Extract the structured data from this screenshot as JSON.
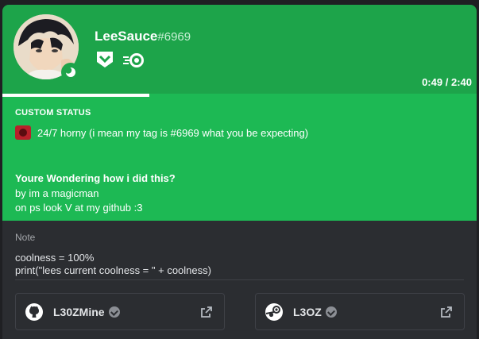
{
  "profile": {
    "username": "LeeSauce",
    "discriminator": "#6969",
    "avatar_alt": "user avatar",
    "status": "idle"
  },
  "badges": [
    "hypesquad-brilliance-icon",
    "nitro-boost-icon"
  ],
  "activity": {
    "elapsed": "0:49",
    "separator": "/",
    "total": "2:40",
    "progress_fraction": 0.31
  },
  "custom_status": {
    "title": "CUSTOM STATUS",
    "text": "24/7 horny (i mean my tag is #6969 what you be expecting)"
  },
  "about": {
    "heading": "Youre Wondering how i did this?",
    "line1": "by im a magicman",
    "line2": "on ps look V at my github :3"
  },
  "note": {
    "label": "Note",
    "text": "coolness = 100%\nprint(\"lees current coolness = \" + coolness)"
  },
  "connections": [
    {
      "service": "github",
      "name": "L30ZMine",
      "verified": true
    },
    {
      "service": "steam",
      "name": "L3OZ",
      "verified": true
    }
  ],
  "colors": {
    "header": "#1da44a",
    "accent": "#1db954",
    "background": "#2b2d31"
  }
}
